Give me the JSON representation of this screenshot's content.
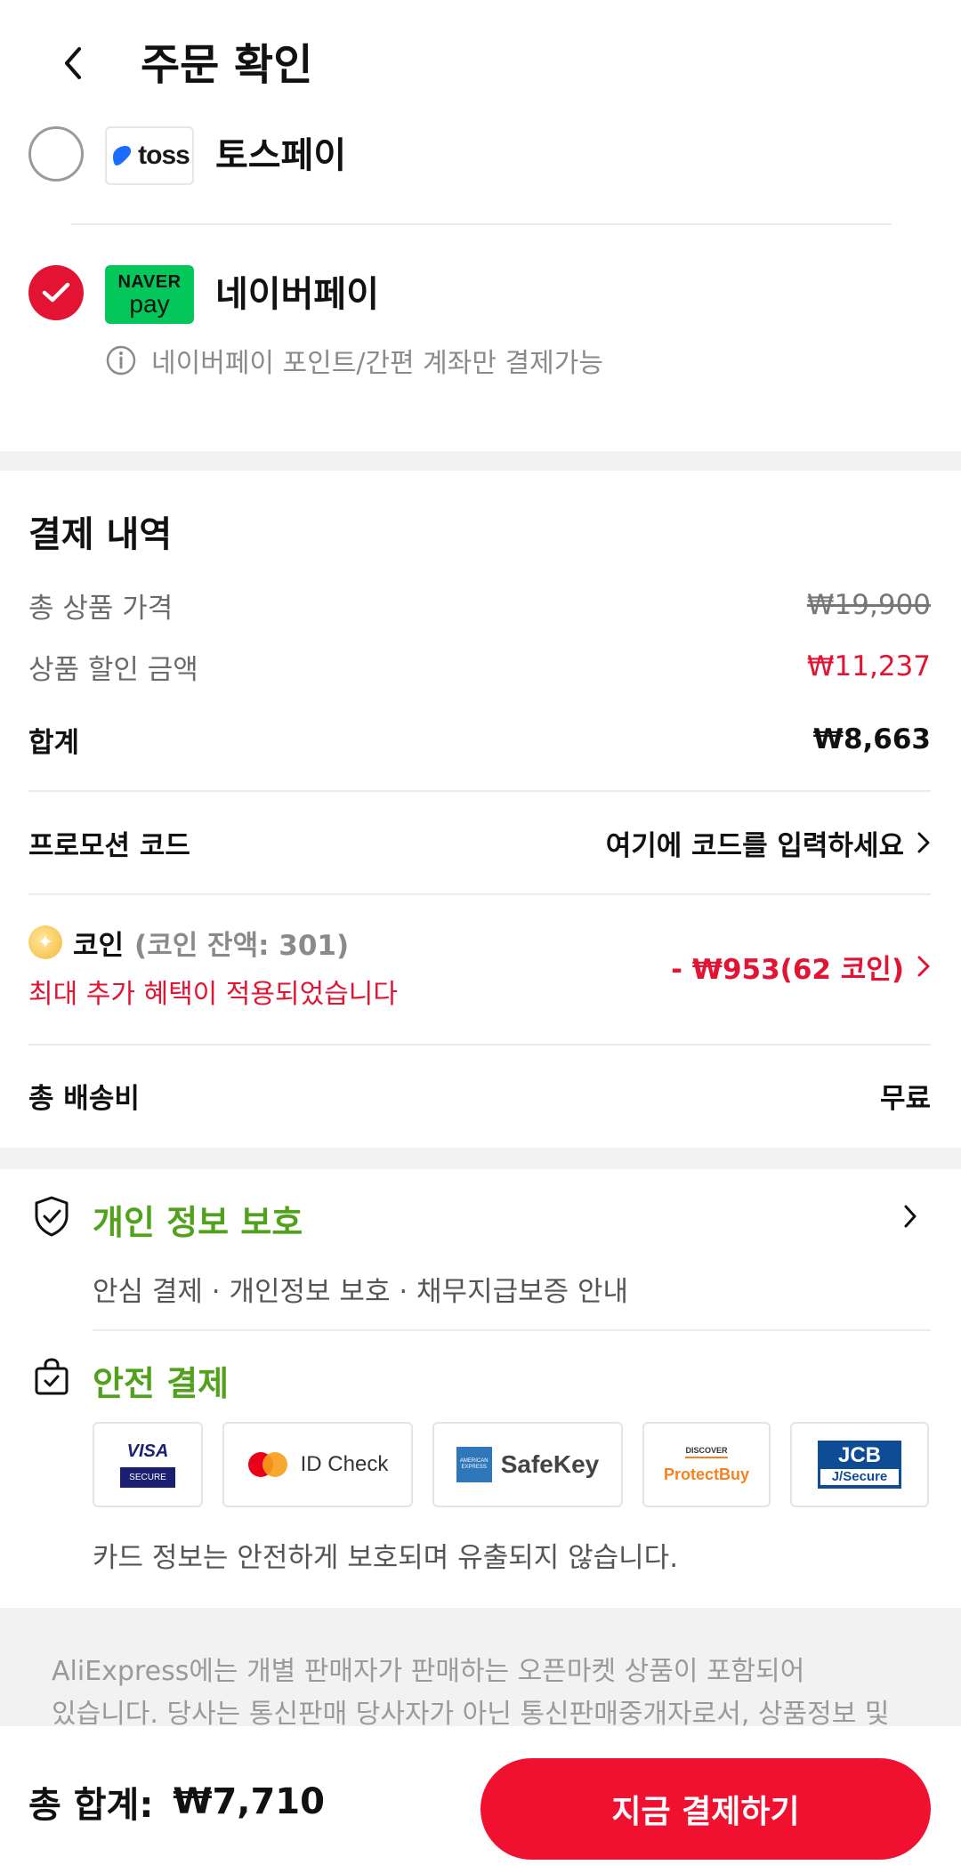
{
  "header": {
    "title": "주문 확인"
  },
  "payment_methods": [
    {
      "logo_text": "toss",
      "name": "토스페이",
      "selected": false
    },
    {
      "logo_top": "NAVER",
      "logo_bottom": "pay",
      "name": "네이버페이",
      "selected": true,
      "note": "네이버페이 포인트/간편 계좌만 결제가능"
    }
  ],
  "summary": {
    "title": "결제 내역",
    "total_product_label": "총 상품 가격",
    "total_product_value": "₩19,900",
    "discount_label": "상품 할인 금액",
    "discount_value": "₩11,237",
    "subtotal_label": "합계",
    "subtotal_value": "₩8,663",
    "promo_label": "프로모션 코드",
    "promo_value": "여기에 코드를 입력하세요",
    "coin_label": "코인",
    "coin_balance": "(코인 잔액: 301)",
    "coin_benefit": "최대 추가 혜택이 적용되었습니다",
    "coin_value": "- ₩953(62 코인)",
    "shipping_label": "총 배송비",
    "shipping_value": "무료"
  },
  "privacy": {
    "title": "개인 정보 보호",
    "subtitle": "안심 결제 · 개인정보 보호 · 채무지급보증 안내"
  },
  "safe_payment": {
    "title": "안전 결제",
    "cards": [
      {
        "top": "VISA",
        "bottom": "SECURE"
      },
      {
        "label": "ID Check"
      },
      {
        "top": "AMERICAN EXPRESS",
        "label": "SafeKey"
      },
      {
        "top": "DISCOVER",
        "label": "ProtectBuy"
      },
      {
        "top": "JCB",
        "bottom": "J/Secure"
      }
    ],
    "note": "카드 정보는 안전하게 보호되며 유출되지 않습니다."
  },
  "disclaimer": {
    "line1": "AliExpress에는 개별 판매자가 판매하는 오픈마켓 상품이 포함되어",
    "line2": "있습니다. 당사는 통신판매 당사자가 아닌 통신판매중개자로서, 상품정보 및"
  },
  "footer": {
    "total_label": "총 합계:",
    "total_value": "₩7,710",
    "pay_button": "지금 결제하기"
  },
  "colors": {
    "accent": "#e31433",
    "button": "#f0102f",
    "green": "#52a11c",
    "naver": "#03c75a"
  }
}
